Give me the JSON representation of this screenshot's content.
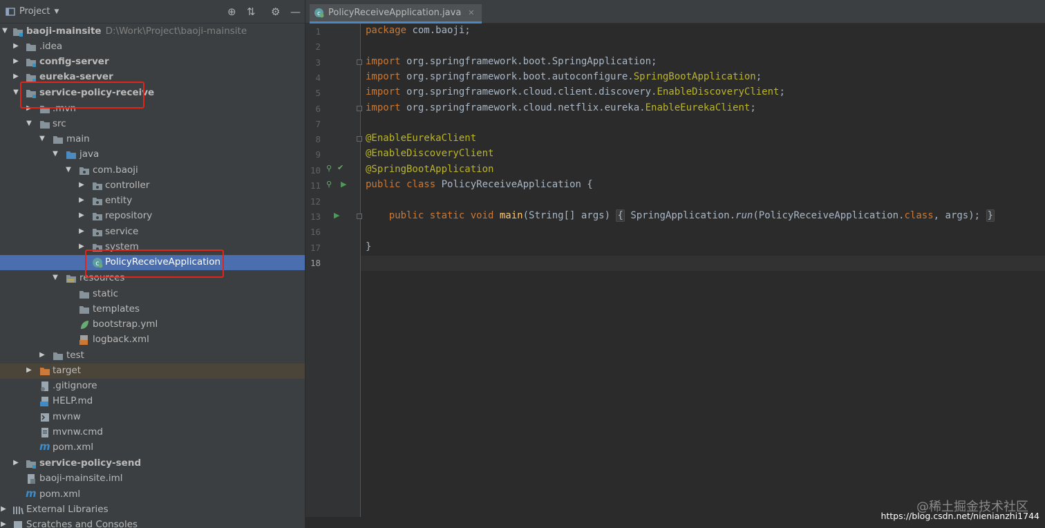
{
  "project_panel": {
    "title": "Project",
    "tree": [
      {
        "label": "baoji-mainsite",
        "path": "D:\\Work\\Project\\baoji-mainsite",
        "bold": true,
        "expanded": true
      },
      {
        "label": ".idea"
      },
      {
        "label": "config-server",
        "bold": true
      },
      {
        "label": "eureka-server",
        "bold": true
      },
      {
        "label": "service-policy-receive",
        "bold": true,
        "expanded": true
      },
      {
        "label": ".mvn"
      },
      {
        "label": "src"
      },
      {
        "label": "main"
      },
      {
        "label": "java"
      },
      {
        "label": "com.baoji"
      },
      {
        "label": "controller"
      },
      {
        "label": "entity"
      },
      {
        "label": "repository"
      },
      {
        "label": "service"
      },
      {
        "label": "system"
      },
      {
        "label": "PolicyReceiveApplication",
        "selected": true
      },
      {
        "label": "resources"
      },
      {
        "label": "static"
      },
      {
        "label": "templates"
      },
      {
        "label": "bootstrap.yml"
      },
      {
        "label": "logback.xml"
      },
      {
        "label": "test"
      },
      {
        "label": "target"
      },
      {
        "label": ".gitignore"
      },
      {
        "label": "HELP.md"
      },
      {
        "label": "mvnw"
      },
      {
        "label": "mvnw.cmd"
      },
      {
        "label": "pom.xml"
      },
      {
        "label": "service-policy-send",
        "bold": true
      },
      {
        "label": "baoji-mainsite.iml"
      },
      {
        "label": "pom.xml"
      },
      {
        "label": "External Libraries"
      },
      {
        "label": "Scratches and Consoles"
      }
    ]
  },
  "editor": {
    "tab_label": "PolicyReceiveApplication.java",
    "line_numbers": [
      "1",
      "2",
      "3",
      "4",
      "5",
      "6",
      "7",
      "8",
      "9",
      "10",
      "11",
      "12",
      "13",
      "16",
      "17",
      "18"
    ],
    "lines": {
      "l1_kw": "package",
      "l1_rest": " com.baoji;",
      "l3_kw": "import",
      "l3_rest": " org.springframework.boot.SpringApplication;",
      "l4_kw": "import",
      "l4_pre": " org.springframework.boot.autoconfigure.",
      "l4_cls": "SpringBootApplication",
      "l4_end": ";",
      "l5_kw": "import",
      "l5_pre": " org.springframework.cloud.client.discovery.",
      "l5_cls": "EnableDiscoveryClient",
      "l5_end": ";",
      "l6_kw": "import",
      "l6_pre": " org.springframework.cloud.netflix.eureka.",
      "l6_cls": "EnableEurekaClient",
      "l6_end": ";",
      "l8": "@EnableEurekaClient",
      "l9": "@EnableDiscoveryClient",
      "l10": "@SpringBootApplication",
      "l11_kw": "public class",
      "l11_rest": " PolicyReceiveApplication {",
      "l13_kw": "public static void",
      "l13_fn": "main",
      "l13_args": "(String[] args) ",
      "l13_ob": "{",
      "l13_sa": " SpringApplication.",
      "l13_run": "run",
      "l13_mid": "(PolicyReceiveApplication.",
      "l13_class": "class",
      "l13_tail": ", args); ",
      "l13_cb": "}",
      "l17": "}"
    }
  },
  "watermark": {
    "line1": "@稀土掘金技术社区",
    "line2": "https://blog.csdn.net/nienianzhi1744"
  }
}
